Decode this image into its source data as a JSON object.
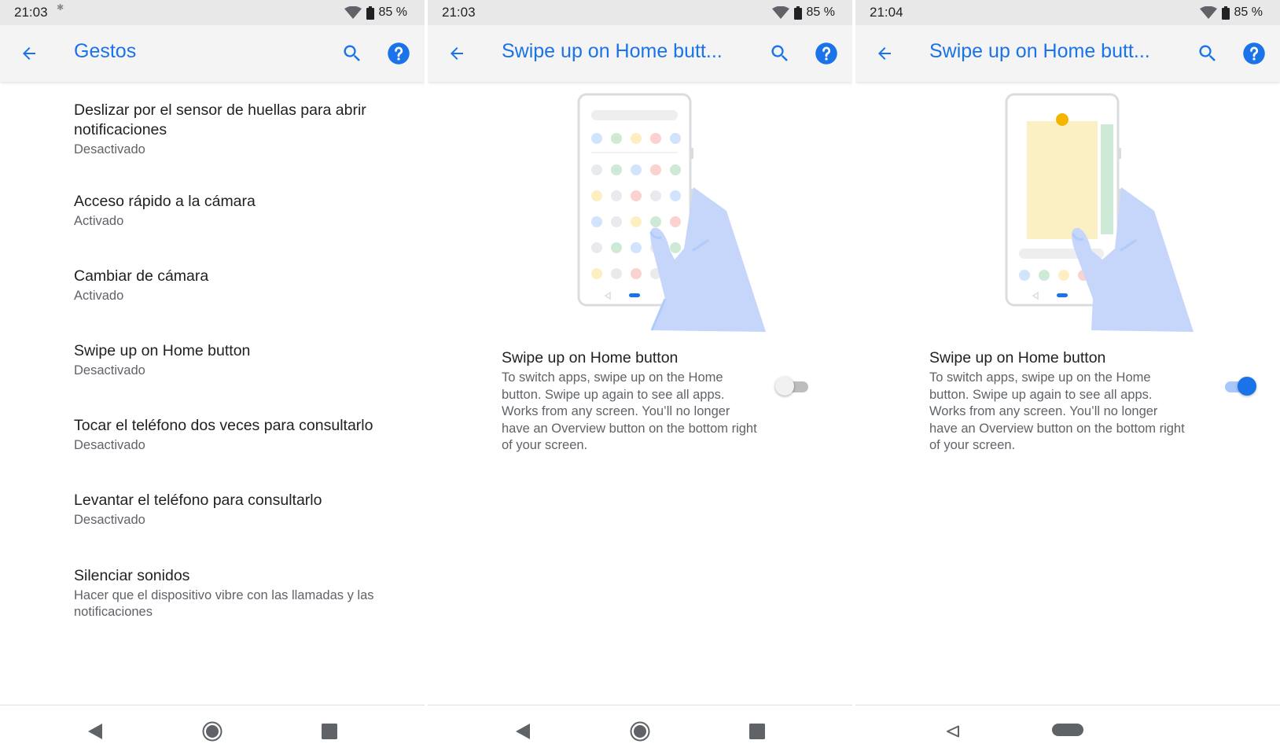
{
  "screens": [
    {
      "status": {
        "time": "21:03",
        "battery": "85 %"
      },
      "app_bar": {
        "title": "Gestos",
        "back_icon": "arrow-back-icon",
        "search_icon": "search-icon",
        "help_icon": "help-icon"
      },
      "settings": [
        {
          "title": "Deslizar por el sensor de huellas para abrir notificaciones",
          "summary": "Desactivado"
        },
        {
          "title": "Acceso rápido a la cámara",
          "summary": "Activado"
        },
        {
          "title": "Cambiar de cámara",
          "summary": "Activado"
        },
        {
          "title": "Swipe up on Home button",
          "summary": "Desactivado"
        },
        {
          "title": "Tocar el teléfono dos veces para consultarlo",
          "summary": "Desactivado"
        },
        {
          "title": "Levantar el teléfono para consultarlo",
          "summary": "Desactivado"
        },
        {
          "title": "Silenciar sonidos",
          "summary": "Hacer que el dispositivo vibre con las llamadas y las notificaciones"
        }
      ],
      "nav": {
        "style": "three-button",
        "icons": [
          "back-triangle-icon",
          "home-circle-icon",
          "recents-square-icon"
        ]
      }
    },
    {
      "status": {
        "time": "21:03",
        "battery": "85 %"
      },
      "app_bar": {
        "title": "Swipe up on Home butt...",
        "back_icon": "arrow-back-icon",
        "search_icon": "search-icon",
        "help_icon": "help-icon"
      },
      "preference": {
        "title": "Swipe up on Home button",
        "summary": "To switch apps, swipe up on the Home button. Swipe up again to see all apps. Works from any screen. You’ll no longer have an Overview button on the bottom right of your screen.",
        "enabled": false
      },
      "nav": {
        "style": "three-button",
        "icons": [
          "back-triangle-icon",
          "home-circle-icon",
          "recents-square-icon"
        ]
      }
    },
    {
      "status": {
        "time": "21:04",
        "battery": "85 %"
      },
      "app_bar": {
        "title": "Swipe up on Home butt...",
        "back_icon": "arrow-back-icon",
        "search_icon": "search-icon",
        "help_icon": "help-icon"
      },
      "preference": {
        "title": "Swipe up on Home button",
        "summary": "To switch apps, swipe up on the Home button. Swipe up again to see all apps. Works from any screen. You’ll no longer have an Overview button on the bottom right of your screen.",
        "enabled": true
      },
      "nav": {
        "style": "gesture",
        "icons": [
          "back-outline-icon",
          "home-pill-icon"
        ]
      }
    }
  ],
  "colors": {
    "accent": "#1a73e8",
    "status_bar": "#e8e8e8",
    "app_bar": "#f4f4f4",
    "text_primary": "#202124",
    "text_secondary": "#5f6368",
    "illustration_hand": "#c6d6fb",
    "illustration_card": "#fbefc4",
    "notification_dot": "#f4b400"
  }
}
